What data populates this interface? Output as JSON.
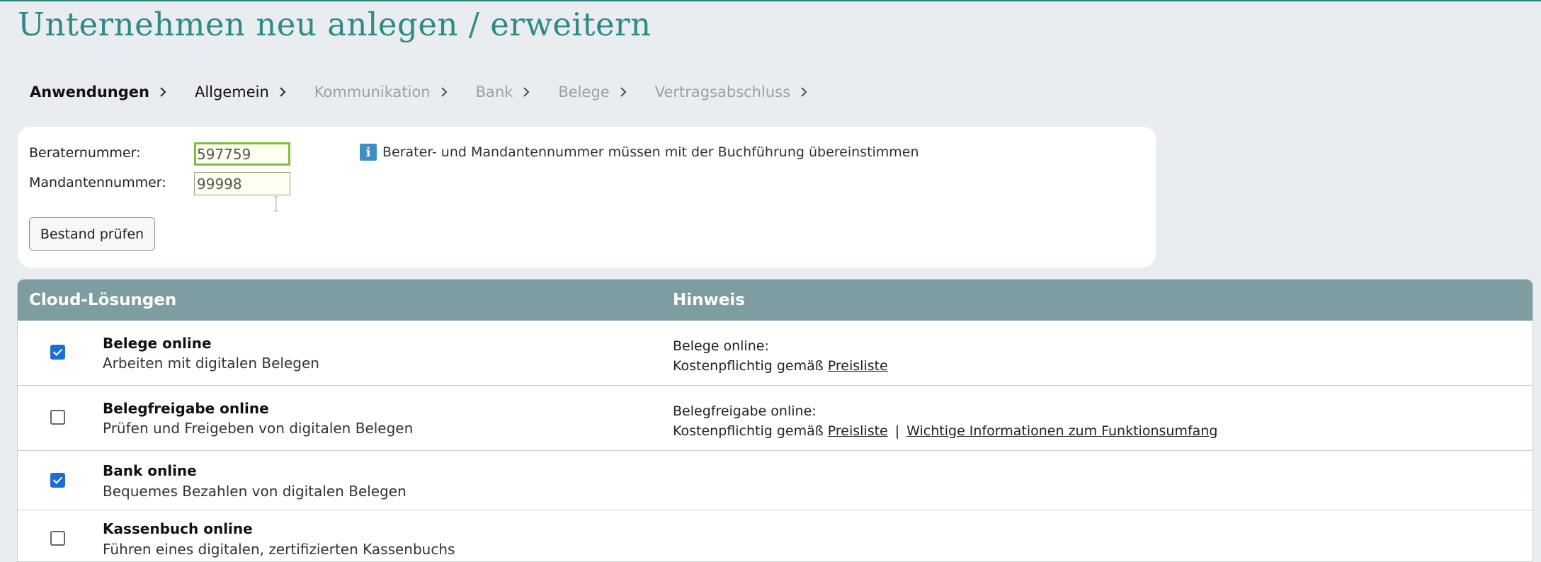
{
  "page": {
    "title": "Unternehmen neu anlegen / erweitern"
  },
  "steps": [
    {
      "label": "Anwendungen",
      "state": "active"
    },
    {
      "label": "Allgemein",
      "state": "normal"
    },
    {
      "label": "Kommunikation",
      "state": "disabled"
    },
    {
      "label": "Bank",
      "state": "disabled"
    },
    {
      "label": "Belege",
      "state": "disabled"
    },
    {
      "label": "Vertragsabschluss",
      "state": "disabled"
    }
  ],
  "form": {
    "berater_label": "Beraternummer:",
    "berater_value": "597759",
    "mandant_label": "Mandantennummer:",
    "mandant_value": "99998",
    "info_icon": "i",
    "info_text": "Berater- und Mandantennummer müssen mit der Buchführung übereinstimmen",
    "check_button": "Bestand prüfen"
  },
  "table": {
    "col_solution": "Cloud-Lösungen",
    "col_hint": "Hinweis",
    "rows": [
      {
        "checked": true,
        "title": "Belege online",
        "subtitle": "Arbeiten mit digitalen Belegen",
        "hint_title": "Belege online:",
        "hint_prefix": "Kostenpflichtig gemäß",
        "hint_link1": "Preisliste",
        "hint_separator": "",
        "hint_link2": ""
      },
      {
        "checked": false,
        "title": "Belegfreigabe online",
        "subtitle": "Prüfen und Freigeben von digitalen Belegen",
        "hint_title": "Belegfreigabe online:",
        "hint_prefix": "Kostenpflichtig gemäß",
        "hint_link1": "Preisliste",
        "hint_separator": "|",
        "hint_link2": "Wichtige Informationen zum Funktionsumfang"
      },
      {
        "checked": true,
        "title": "Bank online",
        "subtitle": "Bequemes Bezahlen von digitalen Belegen",
        "hint_title": "",
        "hint_prefix": "",
        "hint_link1": "",
        "hint_separator": "",
        "hint_link2": ""
      },
      {
        "checked": false,
        "title": "Kassenbuch online",
        "subtitle": "Führen eines digitalen, zertifizierten Kassenbuchs",
        "hint_title": "",
        "hint_prefix": "",
        "hint_link1": "",
        "hint_separator": "",
        "hint_link2": ""
      }
    ]
  },
  "colors": {
    "title": "#2e8a86",
    "header": "#7e9da1",
    "checkbox": "#1a6fd6",
    "focus_border": "#7cbf3c"
  }
}
